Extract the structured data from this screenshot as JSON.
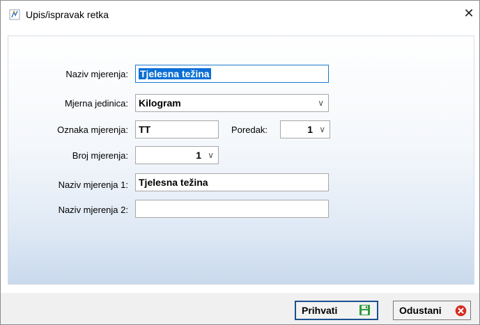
{
  "window": {
    "title": "Upis/ispravak retka"
  },
  "form": {
    "naziv_mjerenja": {
      "label": "Naziv mjerenja:",
      "value": "Tjelesna težina"
    },
    "mjerna_jedinica": {
      "label": "Mjerna jedinica:",
      "value": "Kilogram"
    },
    "oznaka_mjerenja": {
      "label": "Oznaka mjerenja:",
      "value": "TT"
    },
    "poredak": {
      "label": "Poredak:",
      "value": "1"
    },
    "broj_mjerenja": {
      "label": "Broj mjerenja:",
      "value": "1"
    },
    "naziv_mjerenja_1": {
      "label": "Naziv mjerenja 1:",
      "value": "Tjelesna težina"
    },
    "naziv_mjerenja_2": {
      "label": "Naziv mjerenja 2:",
      "value": ""
    }
  },
  "buttons": {
    "accept_label": "Prihvati",
    "cancel_label": "Odustani"
  },
  "icons": {
    "app": "measurement-icon",
    "close": "close-icon",
    "save": "floppy-disk-icon",
    "cancel": "cancel-x-icon"
  },
  "colors": {
    "selection": "#0b6fd6",
    "primary_border": "#1b4f8f",
    "cancel_red": "#d62b1f",
    "save_green": "#2e9a3a"
  }
}
